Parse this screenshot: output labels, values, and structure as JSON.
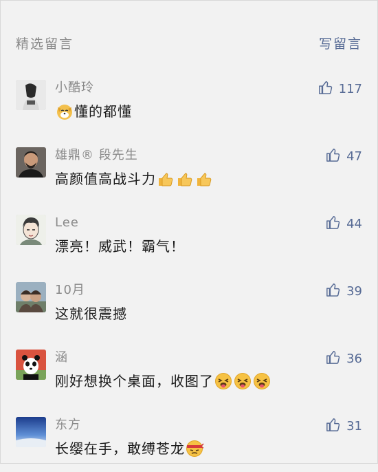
{
  "header": {
    "title": "精选留言",
    "write_label": "写留言"
  },
  "comments": [
    {
      "nick": "小酷玲",
      "text": "懂的都懂",
      "likes": "117",
      "prefix_emoji": "dog-emoji",
      "suffix_emojis": []
    },
    {
      "nick": "雄鼎® 段先生",
      "text": "高颜值高战斗力",
      "likes": "47",
      "suffix_emojis": [
        "thumbs-up-emoji",
        "thumbs-up-emoji",
        "thumbs-up-emoji"
      ]
    },
    {
      "nick": "Lee",
      "text": "漂亮！威武！霸气！",
      "likes": "44",
      "suffix_emojis": []
    },
    {
      "nick": "10月",
      "text": "这就很震撼",
      "likes": "39",
      "suffix_emojis": []
    },
    {
      "nick": "涵",
      "text": "刚好想换个桌面，收图了",
      "likes": "36",
      "suffix_emojis": [
        "tongue-wink-emoji",
        "tongue-wink-emoji",
        "tongue-wink-emoji"
      ]
    },
    {
      "nick": "东方",
      "text": "长缨在手，敢缚苍龙",
      "likes": "31",
      "suffix_emojis": [
        "ninja-emoji"
      ]
    }
  ],
  "colors": {
    "link": "#576b95",
    "muted": "#8a8a8a",
    "background": "#f2f2f2"
  }
}
